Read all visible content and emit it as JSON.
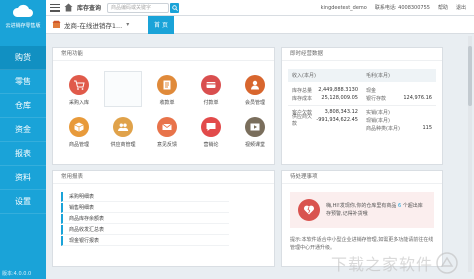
{
  "sidebar": {
    "brand": "云进销存零售版",
    "items": [
      {
        "label": "购货",
        "active": true
      },
      {
        "label": "零售",
        "active": false
      },
      {
        "label": "仓库",
        "active": false
      },
      {
        "label": "资金",
        "active": false
      },
      {
        "label": "报表",
        "active": false
      },
      {
        "label": "资料",
        "active": false
      },
      {
        "label": "设置",
        "active": false
      }
    ],
    "version": "版本:4.0.0.0"
  },
  "topbar": {
    "title": "库存查询",
    "search_placeholder": "商品编码或关键字",
    "user": "kingdeetest_demo",
    "phone_label": "联系电话: 4008300755",
    "help": "帮助",
    "logout": "退出"
  },
  "subbar": {
    "store": "龙商-在线进销存1...",
    "home_tab": "首 页"
  },
  "functions": {
    "title": "常用功能",
    "items": [
      {
        "label": "采购入库",
        "icon": "cart-icon",
        "color": "#e05a4a"
      },
      {
        "label": "",
        "icon": "blank",
        "color": ""
      },
      {
        "label": "收款单",
        "icon": "receipt-icon",
        "color": "#e08a3a"
      },
      {
        "label": "付款单",
        "icon": "payment-icon",
        "color": "#d94f4f"
      },
      {
        "label": "会员管理",
        "icon": "member-icon",
        "color": "#d8662e"
      },
      {
        "label": "商品管理",
        "icon": "goods-icon",
        "color": "#e89a3a"
      },
      {
        "label": "供应商管理",
        "icon": "supplier-icon",
        "color": "#e0a24a"
      },
      {
        "label": "意见反馈",
        "icon": "mail-icon",
        "color": "#e8734a"
      },
      {
        "label": "营销论",
        "icon": "forum-icon",
        "color": "#e24a4a"
      },
      {
        "label": "视频课堂",
        "icon": "video-icon",
        "color": "#7a6e5c"
      }
    ]
  },
  "realtime": {
    "title": "即时经营数据",
    "head_left": "收入(本月)",
    "head_right": "毛利(本月)",
    "left_rows": [
      {
        "k": "库存总量",
        "v": "2,449,888.3130"
      },
      {
        "k": "库存成本",
        "v": "25,128,009.05"
      },
      {
        "k": "客户欠款",
        "v": "3,808,343.12"
      },
      {
        "k": "供应商欠款",
        "v": "-991,934,622.45"
      }
    ],
    "right_rows": [
      {
        "k": "现金",
        "v": ""
      },
      {
        "k": "银行存款",
        "v": "124,976.16"
      },
      {
        "k": "实销(本月)",
        "v": ""
      },
      {
        "k": "现销(本月)",
        "v": ""
      },
      {
        "k": "商品种类(本月)",
        "v": "115"
      }
    ]
  },
  "reports": {
    "title": "常用报表",
    "items": [
      "采购明细表",
      "销售明细表",
      "商品库存余额表",
      "商品收发汇总表",
      "现金银行报表"
    ]
  },
  "todo": {
    "title": "待处理事项",
    "card_text_1": "嗨,HI!发现你,你的仓库里有商品",
    "card_count": "6",
    "card_text_2": "个超出库存预警,记得补货哦",
    "note": "提示:本软件适合中小型企业进销存管理,如需更多功能请前往在线管理中心开通升级。"
  },
  "watermark": {
    "text": "下载之家软件"
  }
}
